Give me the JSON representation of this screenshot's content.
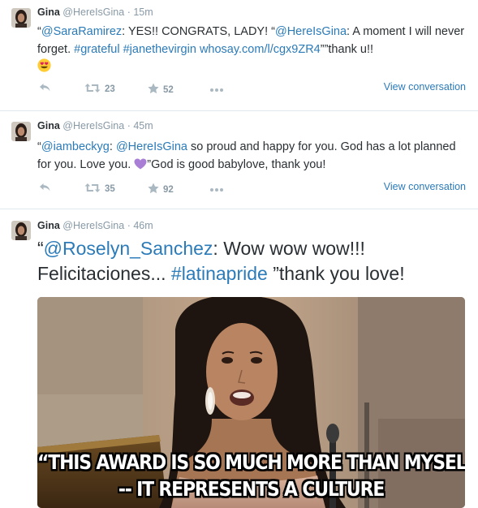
{
  "tweets": [
    {
      "name": "Gina",
      "handle": "@HereIsGina",
      "dot": "·",
      "time": "15m",
      "text": {
        "q_open": "“",
        "m1": "@SaraRamirez",
        "t1": ": YES!! CONGRATS, LADY! “",
        "m2": "@HereIsGina",
        "t2": ": A moment I will never forget. ",
        "h1": "#grateful",
        "sp1": " ",
        "h2": "#janethevirgin",
        "sp2": " ",
        "url": "whosay.com/l/cgx9ZR4",
        "t3": "””thank u!!"
      },
      "emoji": "heart-eyes",
      "retweets": "23",
      "favorites": "52",
      "view_conversation": "View conversation"
    },
    {
      "name": "Gina",
      "handle": "@HereIsGina",
      "dot": "·",
      "time": "45m",
      "text": {
        "q_open": "“",
        "m1": "@iambeckyg",
        "t1": ": ",
        "m2": "@HereIsGina",
        "t2": " so proud and happy for you. God has a lot planned for you. Love you. ",
        "t3": "”God is good babylove, thank you!"
      },
      "emoji": "purple-heart",
      "retweets": "35",
      "favorites": "92",
      "view_conversation": "View conversation"
    },
    {
      "name": "Gina",
      "handle": "@HereIsGina",
      "dot": "·",
      "time": "46m",
      "text": {
        "q_open": "“",
        "m1": "@Roselyn_Sanchez",
        "t1": ": Wow wow wow!!! Felicitaciones... ",
        "h1": "#latinapride",
        "t2": " ”thank you love!"
      },
      "media": {
        "caption_line1": "“THIS AWARD IS SO MUCH MORE THAN MYSELF",
        "caption_line2": "-- IT REPRESENTS A CULTURE"
      }
    }
  ],
  "colors": {
    "link": "#2b7bb9",
    "meta": "#8899a6",
    "text": "#292f33",
    "border": "#e1e8ed"
  },
  "icons": [
    "reply-icon",
    "retweet-icon",
    "favorite-icon",
    "more-icon"
  ]
}
